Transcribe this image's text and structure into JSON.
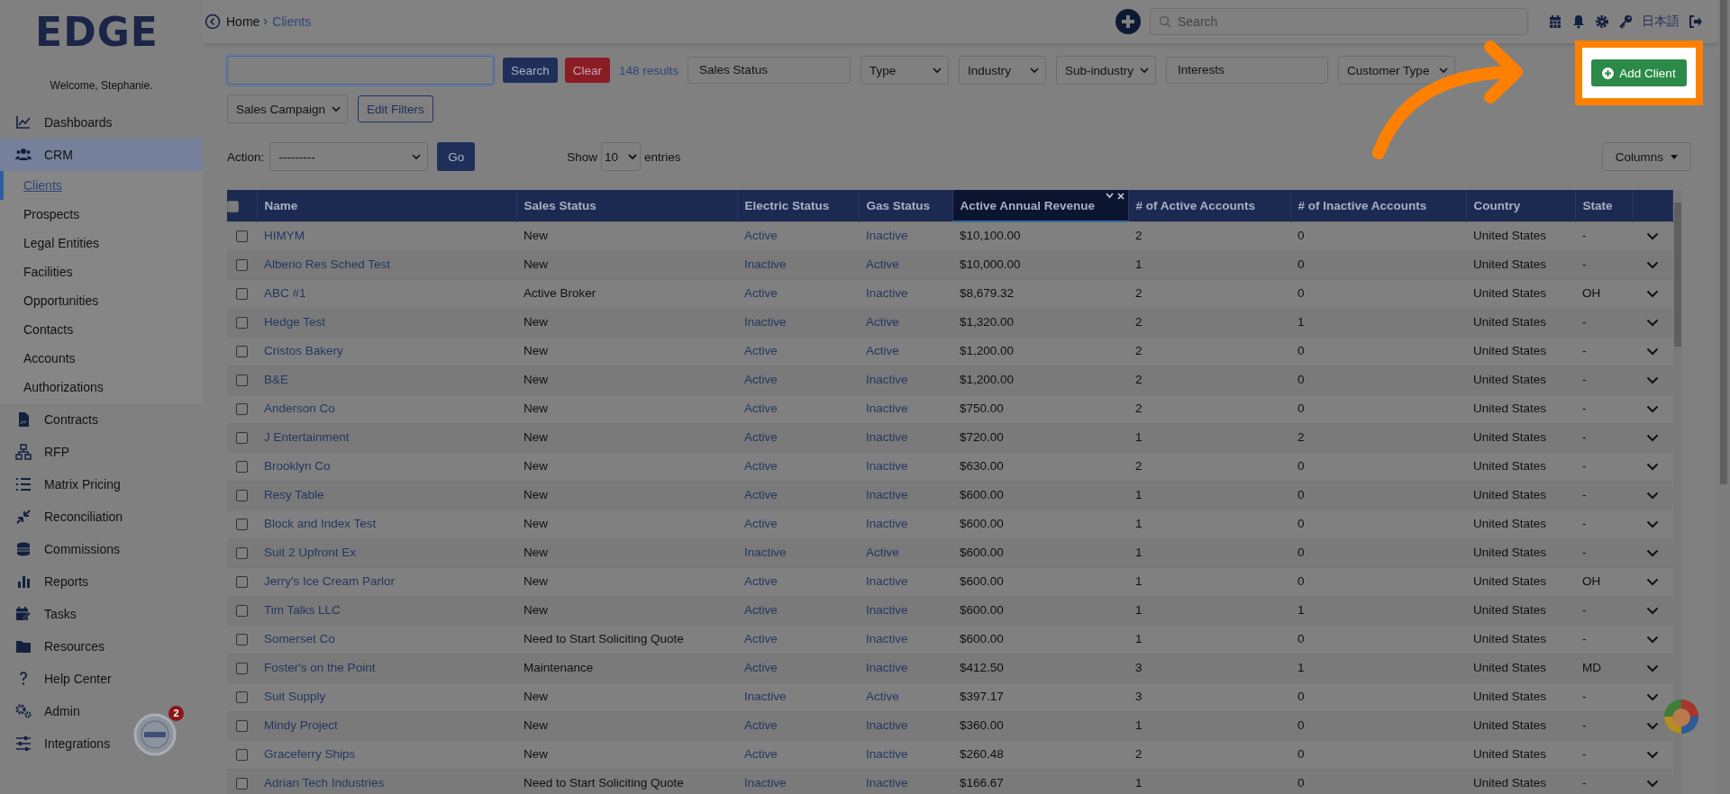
{
  "sidebar": {
    "logo": "EDGE",
    "welcome": "Welcome, Stephanie.",
    "items": [
      {
        "label": "Dashboards",
        "expanded": false
      },
      {
        "label": "CRM",
        "expanded": true,
        "children": [
          {
            "label": "Clients",
            "selected": true
          },
          {
            "label": "Prospects",
            "selected": false
          },
          {
            "label": "Legal Entities",
            "selected": false
          },
          {
            "label": "Facilities",
            "selected": false
          },
          {
            "label": "Opportunities",
            "selected": false
          },
          {
            "label": "Contacts",
            "selected": false
          },
          {
            "label": "Accounts",
            "selected": false
          },
          {
            "label": "Authorizations",
            "selected": false
          }
        ]
      },
      {
        "label": "Contracts",
        "expanded": false
      },
      {
        "label": "RFP",
        "expanded": false
      },
      {
        "label": "Matrix Pricing",
        "expanded": false
      },
      {
        "label": "Reconciliation",
        "expanded": false
      },
      {
        "label": "Commissions",
        "expanded": false
      },
      {
        "label": "Reports",
        "expanded": false
      },
      {
        "label": "Tasks",
        "expanded": false
      },
      {
        "label": "Resources",
        "expanded": false
      },
      {
        "label": "Help Center",
        "expanded": false
      },
      {
        "label": "Admin",
        "expanded": false
      },
      {
        "label": "Integrations",
        "expanded": false
      }
    ],
    "widget_badge": "2"
  },
  "topbar": {
    "breadcrumb": [
      "Home",
      "Clients"
    ],
    "search": {
      "placeholder": "Search"
    },
    "language": "日本語"
  },
  "filters": {
    "search_button": "Search",
    "clear_button": "Clear",
    "results": "148 results",
    "fields": [
      {
        "kind": "input",
        "text": "Sales Status"
      },
      {
        "kind": "select",
        "text": "Type"
      },
      {
        "kind": "select",
        "text": "Industry"
      },
      {
        "kind": "select",
        "text": "Sub-industry"
      },
      {
        "kind": "input",
        "text": "Interests"
      },
      {
        "kind": "select",
        "text": "Customer Type"
      },
      {
        "kind": "select",
        "text": "Sales Campaign"
      }
    ],
    "edit_filters": "Edit Filters"
  },
  "add_client": "Add Client",
  "action": {
    "label": "Action:",
    "value": "---------",
    "go": "Go"
  },
  "show": {
    "prefix": "Show",
    "value": "10",
    "suffix": "entries"
  },
  "columns_button": "Columns",
  "table": {
    "header_checked": false,
    "columns": [
      {
        "label": "Name",
        "active": false
      },
      {
        "label": "Sales Status",
        "active": false
      },
      {
        "label": "Electric Status",
        "active": false
      },
      {
        "label": "Gas Status",
        "active": false
      },
      {
        "label": "Active Annual Revenue",
        "active": true
      },
      {
        "label": "# of Active Accounts",
        "active": false
      },
      {
        "label": "# of Inactive Accounts",
        "active": false
      },
      {
        "label": "Country",
        "active": false
      },
      {
        "label": "State",
        "active": false
      }
    ],
    "rows": [
      {
        "checked": false,
        "cells": [
          "HIMYM",
          "New",
          "Active",
          "Inactive",
          "$10,100.00",
          "2",
          "0",
          "United States",
          "-"
        ]
      },
      {
        "checked": false,
        "cells": [
          "Alberio Res Sched Test",
          "New",
          "Inactive",
          "Active",
          "$10,000.00",
          "1",
          "0",
          "United States",
          "-"
        ]
      },
      {
        "checked": false,
        "cells": [
          "ABC #1",
          "Active Broker",
          "Active",
          "Inactive",
          "$8,679.32",
          "2",
          "0",
          "United States",
          "OH"
        ]
      },
      {
        "checked": false,
        "cells": [
          "Hedge Test",
          "New",
          "Inactive",
          "Active",
          "$1,320.00",
          "2",
          "1",
          "United States",
          "-"
        ]
      },
      {
        "checked": false,
        "cells": [
          "Cristos Bakery",
          "New",
          "Active",
          "Active",
          "$1,200.00",
          "2",
          "0",
          "United States",
          "-"
        ]
      },
      {
        "checked": false,
        "cells": [
          "B&E",
          "New",
          "Active",
          "Inactive",
          "$1,200.00",
          "2",
          "0",
          "United States",
          "-"
        ]
      },
      {
        "checked": false,
        "cells": [
          "Anderson Co",
          "New",
          "Active",
          "Inactive",
          "$750.00",
          "2",
          "0",
          "United States",
          "-"
        ]
      },
      {
        "checked": false,
        "cells": [
          "J Entertainment",
          "New",
          "Active",
          "Inactive",
          "$720.00",
          "1",
          "2",
          "United States",
          "-"
        ]
      },
      {
        "checked": false,
        "cells": [
          "Brooklyn Co",
          "New",
          "Active",
          "Inactive",
          "$630.00",
          "2",
          "0",
          "United States",
          "-"
        ]
      },
      {
        "checked": false,
        "cells": [
          "Resy Table",
          "New",
          "Active",
          "Inactive",
          "$600.00",
          "1",
          "0",
          "United States",
          "-"
        ]
      },
      {
        "checked": false,
        "cells": [
          "Block and Index Test",
          "New",
          "Active",
          "Inactive",
          "$600.00",
          "1",
          "0",
          "United States",
          "-"
        ]
      },
      {
        "checked": false,
        "cells": [
          "Suit 2 Upfront Ex",
          "New",
          "Inactive",
          "Active",
          "$600.00",
          "1",
          "0",
          "United States",
          "-"
        ]
      },
      {
        "checked": false,
        "cells": [
          "Jerry's Ice Cream Parlor",
          "New",
          "Active",
          "Inactive",
          "$600.00",
          "1",
          "0",
          "United States",
          "OH"
        ]
      },
      {
        "checked": false,
        "cells": [
          "Tim Talks LLC",
          "New",
          "Active",
          "Inactive",
          "$600.00",
          "1",
          "1",
          "United States",
          "-"
        ]
      },
      {
        "checked": false,
        "cells": [
          "Somerset Co",
          "Need to Start Soliciting Quote",
          "Active",
          "Inactive",
          "$600.00",
          "1",
          "0",
          "United States",
          "-"
        ]
      },
      {
        "checked": false,
        "cells": [
          "Foster's on the Point",
          "Maintenance",
          "Active",
          "Inactive",
          "$412.50",
          "3",
          "1",
          "United States",
          "MD"
        ]
      },
      {
        "checked": false,
        "cells": [
          "Suit Supply",
          "New",
          "Inactive",
          "Active",
          "$397.17",
          "3",
          "0",
          "United States",
          "-"
        ]
      },
      {
        "checked": false,
        "cells": [
          "Mindy Project",
          "New",
          "Active",
          "Inactive",
          "$360.00",
          "1",
          "0",
          "United States",
          "-"
        ]
      },
      {
        "checked": false,
        "cells": [
          "Graceferry Ships",
          "New",
          "Active",
          "Inactive",
          "$260.48",
          "2",
          "0",
          "United States",
          "-"
        ]
      },
      {
        "checked": false,
        "cells": [
          "Adrian Tech Industries",
          "Need to Start Soliciting Quote",
          "Inactive",
          "Inactive",
          "$166.67",
          "1",
          "0",
          "United States",
          "-"
        ]
      }
    ]
  }
}
